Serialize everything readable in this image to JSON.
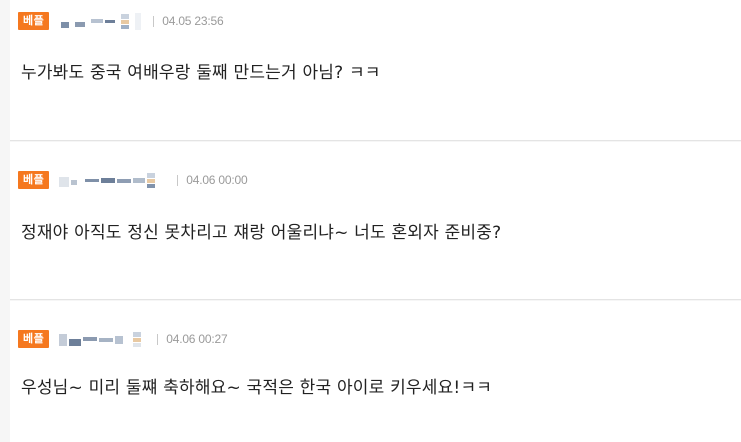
{
  "comments": [
    {
      "badge": "베플",
      "date": "04.05 23:56",
      "text": "누가봐도 중국 여배우랑 둘째 만드는거 아님? ㅋㅋ"
    },
    {
      "badge": "베플",
      "date": "04.06 00:00",
      "text": "정재야 아직도 정신 못차리고 쟤랑 어울리냐~ 너도 혼외자 준비중?"
    },
    {
      "badge": "베플",
      "date": "04.06 00:27",
      "text": "우성님~ 미리 둘쨰 축하해요~ 국적은 한국 아이로 키우세요!ㅋㅋ"
    }
  ],
  "colors": {
    "badge_bg": "#f5781f",
    "badge_text": "#ffffff",
    "date_text": "#9a9a9a",
    "comment_text": "#222222",
    "divider": "#e4e4e4",
    "page_bg": "#f6f6f6"
  }
}
